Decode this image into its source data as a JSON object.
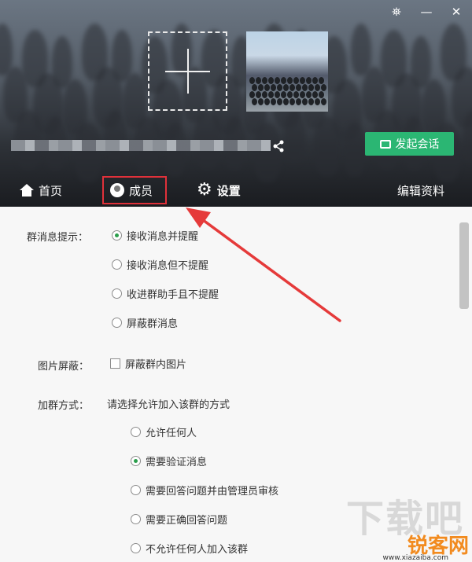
{
  "header": {
    "window_controls": [
      "⛯",
      "—",
      "✕"
    ],
    "start_chat_label": "发起会话"
  },
  "tabs": {
    "home": "首页",
    "members": "成员",
    "settings": "设置",
    "edit_profile": "编辑资料"
  },
  "settings": {
    "msg_notify": {
      "label": "群消息提示：",
      "options": [
        "接收消息并提醒",
        "接收消息但不提醒",
        "收进群助手且不提醒",
        "屏蔽群消息"
      ],
      "selected": 0
    },
    "image_block": {
      "label": "图片屏蔽：",
      "option": "屏蔽群内图片",
      "checked": false
    },
    "join_method": {
      "label": "加群方式：",
      "hint": "请选择允许加入该群的方式",
      "options": [
        "允许任何人",
        "需要验证消息",
        "需要回答问题并由管理员审核",
        "需要正确回答问题",
        "不允许任何人加入该群"
      ],
      "selected": 1
    }
  },
  "watermark": {
    "top": "下载吧",
    "brand": "锐客网",
    "site": "www.xiazaiba.com"
  },
  "colors": {
    "accent_green": "#2bb673",
    "highlight_red": "#e0313a"
  }
}
